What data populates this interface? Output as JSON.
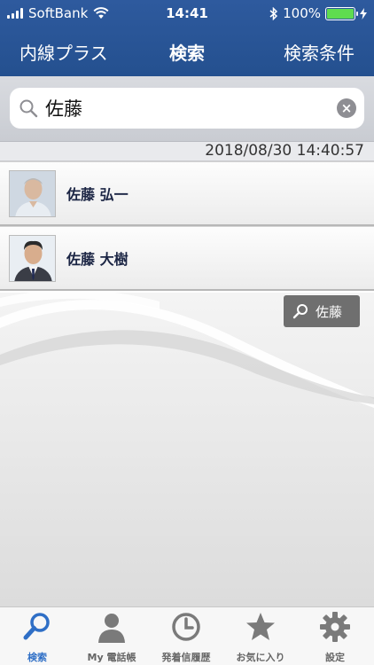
{
  "status_bar": {
    "carrier": "SoftBank",
    "time": "14:41",
    "battery_percent": "100%",
    "battery_level": 1.0
  },
  "nav": {
    "left_label": "内線プラス",
    "title": "検索",
    "right_label": "検索条件"
  },
  "search": {
    "value": "佐藤",
    "icon": "search-icon",
    "clear_icon": "clear-icon"
  },
  "results": {
    "timestamp": "2018/08/30 14:40:57",
    "items": [
      {
        "name": "佐藤 弘一",
        "avatar": "person-photo"
      },
      {
        "name": "佐藤 大樹",
        "avatar": "person-photo"
      }
    ]
  },
  "search_tag": {
    "label": "佐藤",
    "icon": "search-icon"
  },
  "tabbar": {
    "active_color": "#2f6fc6",
    "items": [
      {
        "label": "検索",
        "icon": "search-icon",
        "active": true
      },
      {
        "label": "My 電話帳",
        "icon": "person-icon",
        "active": false
      },
      {
        "label": "発着信履歴",
        "icon": "clock-icon",
        "active": false
      },
      {
        "label": "お気に入り",
        "icon": "star-icon",
        "active": false
      },
      {
        "label": "設定",
        "icon": "gear-icon",
        "active": false
      }
    ]
  },
  "colors": {
    "nav_background": "#2a5595",
    "accent": "#2f6fc6"
  }
}
